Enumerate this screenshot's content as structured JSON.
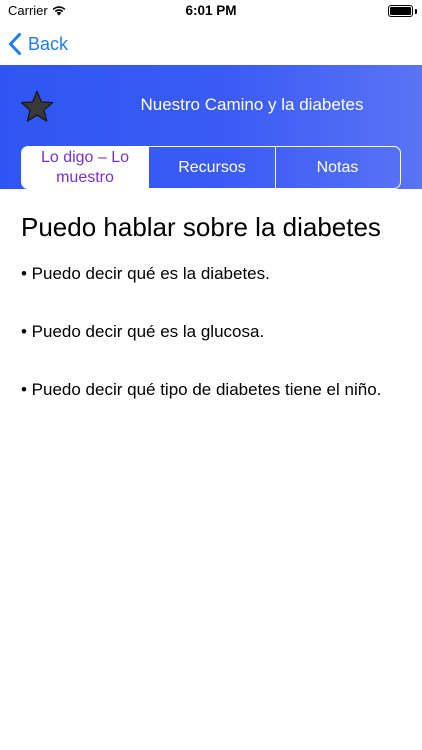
{
  "status_bar": {
    "carrier": "Carrier",
    "time": "6:01 PM",
    "wifi_icon": "wifi-icon",
    "battery_icon": "battery-icon"
  },
  "nav": {
    "back_label": "Back",
    "back_icon": "chevron-left-icon",
    "accent_color": "#1f7cf0"
  },
  "header": {
    "title": "Nuestro Camino y la diabetes",
    "favorite_icon": "star-icon",
    "background_color": "#3b5cf5"
  },
  "tabs": [
    {
      "label": "Lo digo – Lo muestro",
      "selected": true
    },
    {
      "label": "Recursos",
      "selected": false
    },
    {
      "label": "Notas",
      "selected": false
    }
  ],
  "selected_tab_text_color": "#7a2fd0",
  "content": {
    "heading": "Puedo hablar sobre la diabetes",
    "bullets": [
      "• Puedo decir qué es la diabetes.",
      "• Puedo decir qué es la glucosa.",
      "• Puedo decir qué tipo de diabetes tiene el niño."
    ]
  }
}
